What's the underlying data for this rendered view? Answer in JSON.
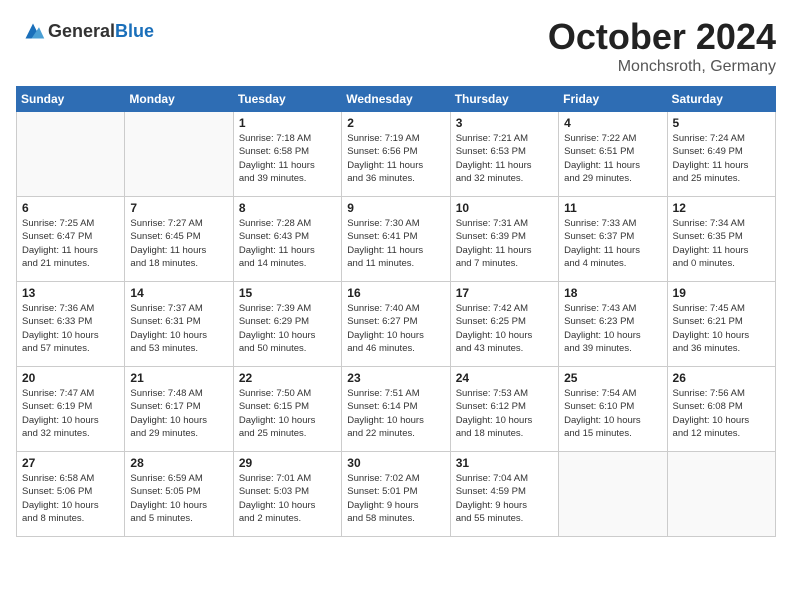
{
  "header": {
    "logo_general": "General",
    "logo_blue": "Blue",
    "month": "October 2024",
    "location": "Monchsroth, Germany"
  },
  "days_of_week": [
    "Sunday",
    "Monday",
    "Tuesday",
    "Wednesday",
    "Thursday",
    "Friday",
    "Saturday"
  ],
  "weeks": [
    [
      {
        "day": "",
        "empty": true
      },
      {
        "day": "",
        "empty": true
      },
      {
        "day": "1",
        "lines": [
          "Sunrise: 7:18 AM",
          "Sunset: 6:58 PM",
          "Daylight: 11 hours",
          "and 39 minutes."
        ]
      },
      {
        "day": "2",
        "lines": [
          "Sunrise: 7:19 AM",
          "Sunset: 6:56 PM",
          "Daylight: 11 hours",
          "and 36 minutes."
        ]
      },
      {
        "day": "3",
        "lines": [
          "Sunrise: 7:21 AM",
          "Sunset: 6:53 PM",
          "Daylight: 11 hours",
          "and 32 minutes."
        ]
      },
      {
        "day": "4",
        "lines": [
          "Sunrise: 7:22 AM",
          "Sunset: 6:51 PM",
          "Daylight: 11 hours",
          "and 29 minutes."
        ]
      },
      {
        "day": "5",
        "lines": [
          "Sunrise: 7:24 AM",
          "Sunset: 6:49 PM",
          "Daylight: 11 hours",
          "and 25 minutes."
        ]
      }
    ],
    [
      {
        "day": "6",
        "lines": [
          "Sunrise: 7:25 AM",
          "Sunset: 6:47 PM",
          "Daylight: 11 hours",
          "and 21 minutes."
        ]
      },
      {
        "day": "7",
        "lines": [
          "Sunrise: 7:27 AM",
          "Sunset: 6:45 PM",
          "Daylight: 11 hours",
          "and 18 minutes."
        ]
      },
      {
        "day": "8",
        "lines": [
          "Sunrise: 7:28 AM",
          "Sunset: 6:43 PM",
          "Daylight: 11 hours",
          "and 14 minutes."
        ]
      },
      {
        "day": "9",
        "lines": [
          "Sunrise: 7:30 AM",
          "Sunset: 6:41 PM",
          "Daylight: 11 hours",
          "and 11 minutes."
        ]
      },
      {
        "day": "10",
        "lines": [
          "Sunrise: 7:31 AM",
          "Sunset: 6:39 PM",
          "Daylight: 11 hours",
          "and 7 minutes."
        ]
      },
      {
        "day": "11",
        "lines": [
          "Sunrise: 7:33 AM",
          "Sunset: 6:37 PM",
          "Daylight: 11 hours",
          "and 4 minutes."
        ]
      },
      {
        "day": "12",
        "lines": [
          "Sunrise: 7:34 AM",
          "Sunset: 6:35 PM",
          "Daylight: 11 hours",
          "and 0 minutes."
        ]
      }
    ],
    [
      {
        "day": "13",
        "lines": [
          "Sunrise: 7:36 AM",
          "Sunset: 6:33 PM",
          "Daylight: 10 hours",
          "and 57 minutes."
        ]
      },
      {
        "day": "14",
        "lines": [
          "Sunrise: 7:37 AM",
          "Sunset: 6:31 PM",
          "Daylight: 10 hours",
          "and 53 minutes."
        ]
      },
      {
        "day": "15",
        "lines": [
          "Sunrise: 7:39 AM",
          "Sunset: 6:29 PM",
          "Daylight: 10 hours",
          "and 50 minutes."
        ]
      },
      {
        "day": "16",
        "lines": [
          "Sunrise: 7:40 AM",
          "Sunset: 6:27 PM",
          "Daylight: 10 hours",
          "and 46 minutes."
        ]
      },
      {
        "day": "17",
        "lines": [
          "Sunrise: 7:42 AM",
          "Sunset: 6:25 PM",
          "Daylight: 10 hours",
          "and 43 minutes."
        ]
      },
      {
        "day": "18",
        "lines": [
          "Sunrise: 7:43 AM",
          "Sunset: 6:23 PM",
          "Daylight: 10 hours",
          "and 39 minutes."
        ]
      },
      {
        "day": "19",
        "lines": [
          "Sunrise: 7:45 AM",
          "Sunset: 6:21 PM",
          "Daylight: 10 hours",
          "and 36 minutes."
        ]
      }
    ],
    [
      {
        "day": "20",
        "lines": [
          "Sunrise: 7:47 AM",
          "Sunset: 6:19 PM",
          "Daylight: 10 hours",
          "and 32 minutes."
        ]
      },
      {
        "day": "21",
        "lines": [
          "Sunrise: 7:48 AM",
          "Sunset: 6:17 PM",
          "Daylight: 10 hours",
          "and 29 minutes."
        ]
      },
      {
        "day": "22",
        "lines": [
          "Sunrise: 7:50 AM",
          "Sunset: 6:15 PM",
          "Daylight: 10 hours",
          "and 25 minutes."
        ]
      },
      {
        "day": "23",
        "lines": [
          "Sunrise: 7:51 AM",
          "Sunset: 6:14 PM",
          "Daylight: 10 hours",
          "and 22 minutes."
        ]
      },
      {
        "day": "24",
        "lines": [
          "Sunrise: 7:53 AM",
          "Sunset: 6:12 PM",
          "Daylight: 10 hours",
          "and 18 minutes."
        ]
      },
      {
        "day": "25",
        "lines": [
          "Sunrise: 7:54 AM",
          "Sunset: 6:10 PM",
          "Daylight: 10 hours",
          "and 15 minutes."
        ]
      },
      {
        "day": "26",
        "lines": [
          "Sunrise: 7:56 AM",
          "Sunset: 6:08 PM",
          "Daylight: 10 hours",
          "and 12 minutes."
        ]
      }
    ],
    [
      {
        "day": "27",
        "lines": [
          "Sunrise: 6:58 AM",
          "Sunset: 5:06 PM",
          "Daylight: 10 hours",
          "and 8 minutes."
        ]
      },
      {
        "day": "28",
        "lines": [
          "Sunrise: 6:59 AM",
          "Sunset: 5:05 PM",
          "Daylight: 10 hours",
          "and 5 minutes."
        ]
      },
      {
        "day": "29",
        "lines": [
          "Sunrise: 7:01 AM",
          "Sunset: 5:03 PM",
          "Daylight: 10 hours",
          "and 2 minutes."
        ]
      },
      {
        "day": "30",
        "lines": [
          "Sunrise: 7:02 AM",
          "Sunset: 5:01 PM",
          "Daylight: 9 hours",
          "and 58 minutes."
        ]
      },
      {
        "day": "31",
        "lines": [
          "Sunrise: 7:04 AM",
          "Sunset: 4:59 PM",
          "Daylight: 9 hours",
          "and 55 minutes."
        ]
      },
      {
        "day": "",
        "empty": true
      },
      {
        "day": "",
        "empty": true
      }
    ]
  ]
}
